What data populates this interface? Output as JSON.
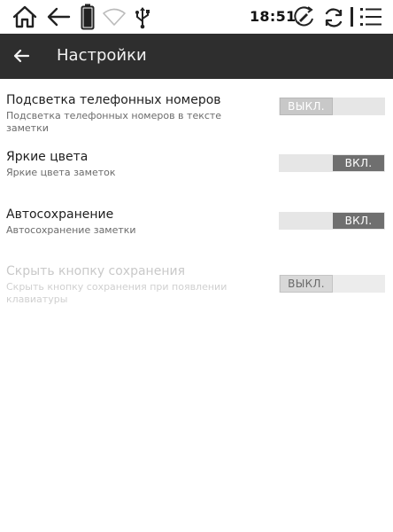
{
  "status_bar": {
    "time": "18:51",
    "icons": [
      "home-icon",
      "back-arrow-icon",
      "battery-icon",
      "wifi-icon",
      "usb-icon",
      "sync-icon",
      "refresh-icon",
      "menu-icon"
    ]
  },
  "app_bar": {
    "title": "Настройки",
    "back_icon": "arrow-left-icon"
  },
  "settings": [
    {
      "label": "Подсветка телефонных номеров",
      "description": "Подсветка телефонных номеров в тексте заметки",
      "toggle": "ВЫКЛ.",
      "state": "off",
      "enabled": true
    },
    {
      "label": "Яркие цвета",
      "description": "Яркие цвета заметок",
      "toggle": "ВКЛ.",
      "state": "on",
      "enabled": true
    },
    {
      "label": "Автосохранение",
      "description": "Автосохранение заметки",
      "toggle": "ВКЛ.",
      "state": "on",
      "enabled": true
    },
    {
      "label": "Скрыть кнопку сохранения",
      "description": "Скрыть кнопку сохранения при появлении клавиатуры",
      "toggle": "ВЫКЛ.",
      "state": "off",
      "enabled": false
    }
  ],
  "colors": {
    "app_bar_bg": "#2e2e2e",
    "toggle_track": "#e6e6e6",
    "toggle_on": "#6f6f6f",
    "toggle_off": "#c8c8c8"
  }
}
